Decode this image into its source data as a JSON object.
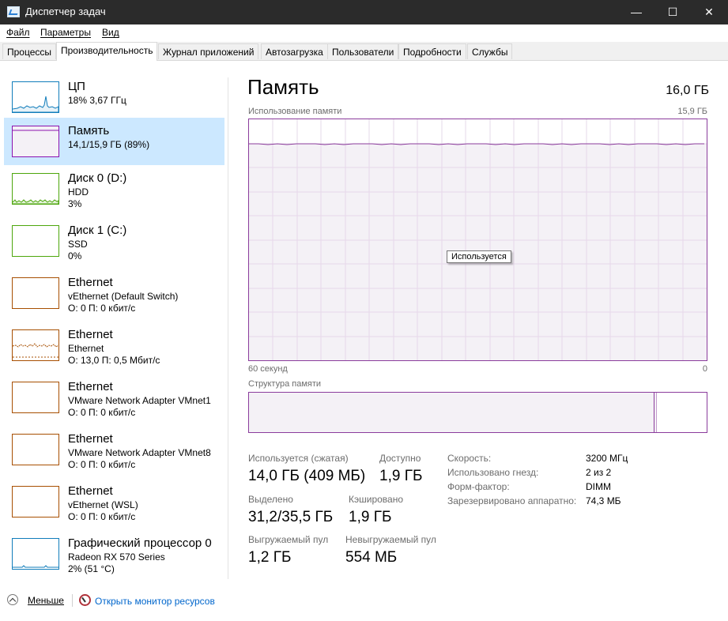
{
  "window": {
    "title": "Диспетчер задач",
    "controls": {
      "minimize": "—",
      "maximize": "☐",
      "close": "✕"
    }
  },
  "menu": [
    "Файл",
    "Параметры",
    "Вид"
  ],
  "tabs": [
    "Процессы",
    "Производительность",
    "Журнал приложений",
    "Автозагрузка",
    "Пользователи",
    "Подробности",
    "Службы"
  ],
  "active_tab": "Производительность",
  "resources": [
    {
      "name": "ЦП",
      "line1": "18%  3,67 ГГц",
      "line2": "",
      "color": "#117dbb",
      "selected": false
    },
    {
      "name": "Память",
      "line1": "14,1/15,9 ГБ (89%)",
      "line2": "",
      "color": "#8b12ae",
      "selected": true
    },
    {
      "name": "Диск 0 (D:)",
      "line1": "HDD",
      "line2": "3%",
      "color": "#4da60c",
      "selected": false
    },
    {
      "name": "Диск 1 (C:)",
      "line1": "SSD",
      "line2": "0%",
      "color": "#4da60c",
      "selected": false
    },
    {
      "name": "Ethernet",
      "line1": "vEthernet (Default Switch)",
      "line2": "О: 0 П: 0 кбит/с",
      "color": "#a74f01",
      "selected": false
    },
    {
      "name": "Ethernet",
      "line1": "Ethernet",
      "line2": "О: 13,0 П: 0,5 Мбит/с",
      "color": "#a74f01",
      "selected": false
    },
    {
      "name": "Ethernet",
      "line1": "VMware Network Adapter VMnet1",
      "line2": "О: 0 П: 0 кбит/с",
      "color": "#a74f01",
      "selected": false
    },
    {
      "name": "Ethernet",
      "line1": "VMware Network Adapter VMnet8",
      "line2": "О: 0 П: 0 кбит/с",
      "color": "#a74f01",
      "selected": false
    },
    {
      "name": "Ethernet",
      "line1": "vEthernet (WSL)",
      "line2": "О: 0 П: 0 кбит/с",
      "color": "#a74f01",
      "selected": false
    },
    {
      "name": "Графический процессор 0",
      "line1": "Radeon RX 570 Series",
      "line2": "2% (51 °C)",
      "color": "#117dbb",
      "selected": false
    }
  ],
  "memory": {
    "title": "Память",
    "total": "16,0 ГБ",
    "usage_label": "Использование памяти",
    "usage_max": "15,9 ГБ",
    "time_left": "60 секунд",
    "time_right": "0",
    "tooltip": "Используется",
    "usage_fraction": 0.89,
    "structure_label": "Структура памяти",
    "structure_used_fraction": 0.885,
    "stats": {
      "in_use_label": "Используется (сжатая)",
      "in_use_value": "14,0 ГБ (409 МБ)",
      "available_label": "Доступно",
      "available_value": "1,9 ГБ",
      "committed_label": "Выделено",
      "committed_value": "31,2/35,5 ГБ",
      "cached_label": "Кэшировано",
      "cached_value": "1,9 ГБ",
      "paged_label": "Выгружаемый пул",
      "paged_value": "1,2 ГБ",
      "nonpaged_label": "Невыгружаемый пул",
      "nonpaged_value": "554 МБ"
    },
    "details": [
      {
        "label": "Скорость:",
        "value": "3200 МГц"
      },
      {
        "label": "Использовано гнезд:",
        "value": "2 из 2"
      },
      {
        "label": "Форм-фактор:",
        "value": "DIMM"
      },
      {
        "label": "Зарезервировано аппаратно:",
        "value": "74,3 МБ"
      }
    ]
  },
  "footer": {
    "less": "Меньше",
    "resource_monitor": "Открыть монитор ресурсов"
  }
}
